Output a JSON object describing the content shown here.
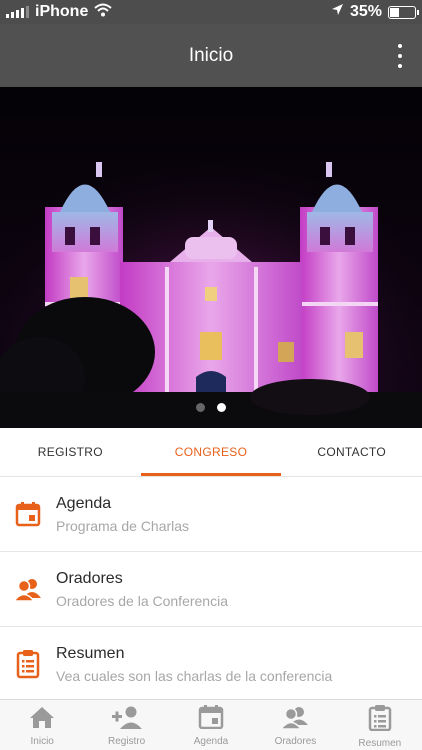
{
  "status_bar": {
    "carrier": "iPhone",
    "battery_percent": "35%",
    "battery_level": 0.35,
    "icons": [
      "signal-icon",
      "wifi-icon",
      "location-arrow-icon",
      "battery-icon"
    ]
  },
  "app_bar": {
    "title": "Inicio",
    "menu_icon": "overflow-menu-icon"
  },
  "hero": {
    "image": "cathedral-night-photo",
    "slides": 2,
    "active_slide": 2
  },
  "tabs": [
    {
      "label": "REGISTRO",
      "active": false
    },
    {
      "label": "CONGRESO",
      "active": true
    },
    {
      "label": "CONTACTO",
      "active": false
    }
  ],
  "menu": [
    {
      "title": "Agenda",
      "subtitle": "Programa de Charlas",
      "icon": "calendar-icon"
    },
    {
      "title": "Oradores",
      "subtitle": "Oradores de la Conferencia",
      "icon": "speakers-icon"
    },
    {
      "title": "Resumen",
      "subtitle": "Vea cuales son las charlas de la conferencia",
      "icon": "clipboard-icon"
    }
  ],
  "bottom_nav": [
    {
      "label": "Inicio",
      "icon": "home-icon"
    },
    {
      "label": "Registro",
      "icon": "add-user-icon"
    },
    {
      "label": "Agenda",
      "icon": "calendar-icon"
    },
    {
      "label": "Oradores",
      "icon": "speakers-icon"
    },
    {
      "label": "Resumen",
      "icon": "clipboard-icon"
    }
  ],
  "colors": {
    "accent": "#e8611a",
    "app_bar": "#515151",
    "status_bar": "#4d4d4d",
    "nav_icon": "#9a9a9a"
  }
}
